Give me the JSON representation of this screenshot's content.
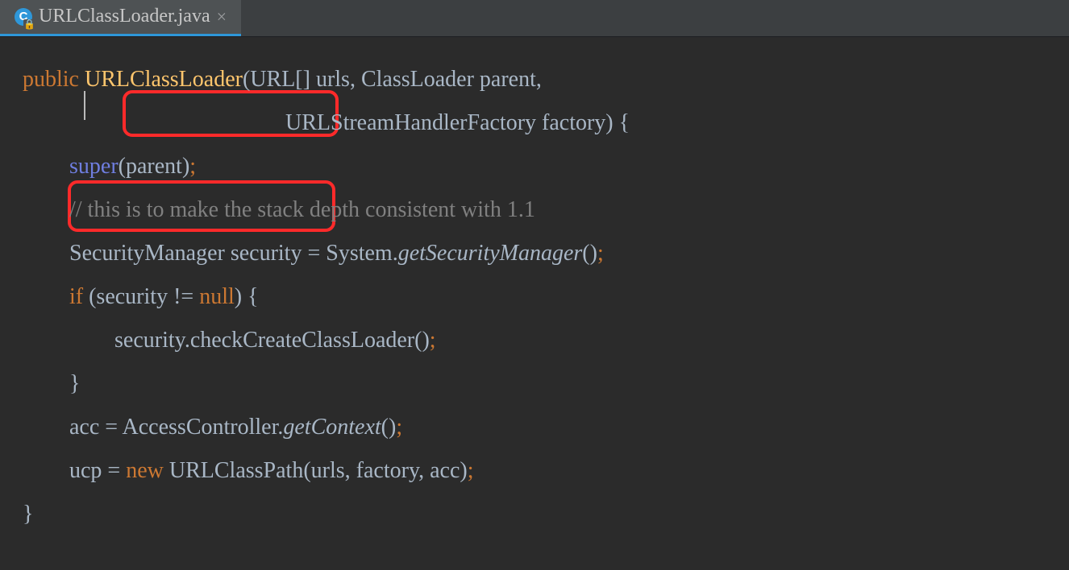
{
  "tab": {
    "filename": "URLClassLoader.java",
    "icon_letter": "C"
  },
  "code": {
    "l1": {
      "public": "public ",
      "ctor": "URLClassLoader",
      "rest": "(URL[] urls, ClassLoader parent,"
    },
    "l2": "URLStreamHandlerFactory factory) {",
    "l3": {
      "super": "super",
      "rest": "(parent)",
      "semi": ";"
    },
    "l4": "// this is to make the stack depth consistent with 1.1",
    "l5": {
      "a": "SecurityManager security = System.",
      "b": "getSecurityManager",
      "c": "()",
      "d": ";"
    },
    "l6": {
      "if": "if ",
      "mid": "(security != ",
      "null": "null",
      "end": ") {"
    },
    "l7": {
      "a": "security.checkCreateClassLoader()",
      "b": ";"
    },
    "l8": "}",
    "l9": {
      "a": "acc = AccessController.",
      "b": "getContext",
      "c": "()",
      "d": ";"
    },
    "l10": {
      "a": "ucp = ",
      "new": "new ",
      "mid": "URLClassPath(urls, factory, acc)",
      "d": ";"
    },
    "l11": "}"
  }
}
